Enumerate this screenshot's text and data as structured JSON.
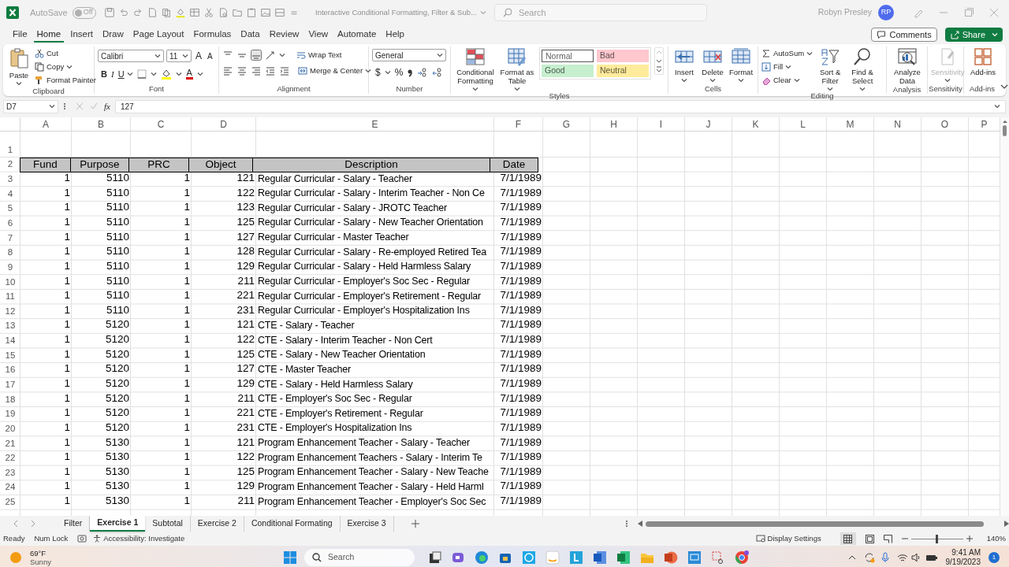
{
  "title_bar": {
    "autosave_label": "AutoSave",
    "autosave_state": "Off",
    "autosave_on": false,
    "document_title": "Interactive Conditional Formatting, Filter & Sub...",
    "search_placeholder": "Search",
    "user_name": "Robyn Presley",
    "user_initials": "RP"
  },
  "menu_tabs": [
    {
      "label": "File",
      "selected": false
    },
    {
      "label": "Home",
      "selected": true
    },
    {
      "label": "Insert",
      "selected": false
    },
    {
      "label": "Draw",
      "selected": false
    },
    {
      "label": "Page Layout",
      "selected": false
    },
    {
      "label": "Formulas",
      "selected": false
    },
    {
      "label": "Data",
      "selected": false
    },
    {
      "label": "Review",
      "selected": false
    },
    {
      "label": "View",
      "selected": false
    },
    {
      "label": "Automate",
      "selected": false
    },
    {
      "label": "Help",
      "selected": false
    }
  ],
  "comments_button": "Comments",
  "share_button": "Share",
  "ribbon": {
    "clipboard": {
      "paste": "Paste",
      "cut": "Cut",
      "copy": "Copy",
      "format_painter": "Format Painter",
      "label": "Clipboard"
    },
    "font": {
      "font_name": "Calibri",
      "font_size": "11",
      "grow": "A",
      "shrink": "A",
      "bold": "B",
      "italic": "I",
      "underline": "U",
      "font_color": "A",
      "label": "Font"
    },
    "alignment": {
      "wrap_text": "Wrap Text",
      "merge_center": "Merge & Center",
      "label": "Alignment"
    },
    "number": {
      "format": "General",
      "currency": "$",
      "percent": "%",
      "label": "Number"
    },
    "styles": {
      "conditional_formatting": "Conditional Formatting",
      "format_as_table": "Format as Table",
      "gallery": [
        {
          "label": "Normal",
          "color": "#ffffff"
        },
        {
          "label": "Bad",
          "color": "#ffc7ce"
        },
        {
          "label": "Good",
          "color": "#c6efce"
        },
        {
          "label": "Neutral",
          "color": "#ffeb9c"
        }
      ],
      "label": "Styles"
    },
    "cells": {
      "buttons": [
        "Insert",
        "Delete",
        "Format"
      ],
      "label": "Cells"
    },
    "editing": {
      "autosum": "AutoSum",
      "fill": "Fill",
      "clear": "Clear",
      "sort_filter": "Sort & Filter",
      "find_select": "Find & Select",
      "label": "Editing"
    },
    "analysis": {
      "analyze_data": "Analyze Data",
      "label": "Analysis"
    },
    "sensitivity": {
      "button": "Sensitivity",
      "disabled": true,
      "label": "Sensitivity"
    },
    "addins": {
      "button": "Add-ins",
      "label": "Add-ins"
    }
  },
  "formula_bar": {
    "name_box": "D7",
    "function_label": "fx",
    "value": "127"
  },
  "sheet": {
    "column_headers": [
      "A",
      "B",
      "C",
      "D",
      "E",
      "F",
      "G",
      "H",
      "I",
      "J",
      "K",
      "L",
      "M",
      "N",
      "O",
      "P"
    ],
    "rows": [
      {
        "number": "1",
        "kind": "blank"
      },
      {
        "number": "2",
        "kind": "header",
        "cells": [
          "Fund",
          "Purpose",
          "PRC",
          "Object",
          "Description",
          "Date"
        ]
      },
      {
        "number": "3",
        "kind": "data",
        "cells": [
          "1",
          "5110",
          "1",
          "121",
          "Regular Curricular - Salary - Teacher",
          "7/1/1989"
        ]
      },
      {
        "number": "4",
        "kind": "data",
        "cells": [
          "1",
          "5110",
          "1",
          "122",
          "Regular Curricular - Salary - Interim Teacher - Non Ce",
          "7/1/1989"
        ]
      },
      {
        "number": "5",
        "kind": "data",
        "cells": [
          "1",
          "5110",
          "1",
          "123",
          "Regular Curricular - Salary - JROTC Teacher",
          "7/1/1989"
        ]
      },
      {
        "number": "6",
        "kind": "data",
        "cells": [
          "1",
          "5110",
          "1",
          "125",
          "Regular Curricular - Salary - New Teacher Orientation",
          "7/1/1989"
        ]
      },
      {
        "number": "7",
        "kind": "data",
        "cells": [
          "1",
          "5110",
          "1",
          "127",
          "Regular Curricular - Master Teacher",
          "7/1/1989"
        ]
      },
      {
        "number": "8",
        "kind": "data",
        "cells": [
          "1",
          "5110",
          "1",
          "128",
          "Regular Curricular - Salary - Re-employed Retired Tea",
          "7/1/1989"
        ]
      },
      {
        "number": "9",
        "kind": "data",
        "cells": [
          "1",
          "5110",
          "1",
          "129",
          "Regular Curricular - Salary - Held Harmless Salary",
          "7/1/1989"
        ]
      },
      {
        "number": "10",
        "kind": "data",
        "cells": [
          "1",
          "5110",
          "1",
          "211",
          "Regular Curricular - Employer's Soc Sec - Regular",
          "7/1/1989"
        ]
      },
      {
        "number": "11",
        "kind": "data",
        "cells": [
          "1",
          "5110",
          "1",
          "221",
          "Regular Curricular - Employer's Retirement - Regular",
          "7/1/1989"
        ]
      },
      {
        "number": "12",
        "kind": "data",
        "cells": [
          "1",
          "5110",
          "1",
          "231",
          "Regular Curricular - Employer's Hospitalization Ins",
          "7/1/1989"
        ]
      },
      {
        "number": "13",
        "kind": "data",
        "cells": [
          "1",
          "5120",
          "1",
          "121",
          "CTE - Salary - Teacher",
          "7/1/1989"
        ]
      },
      {
        "number": "14",
        "kind": "data",
        "cells": [
          "1",
          "5120",
          "1",
          "122",
          "CTE - Salary - Interim Teacher - Non Cert",
          "7/1/1989"
        ]
      },
      {
        "number": "15",
        "kind": "data",
        "cells": [
          "1",
          "5120",
          "1",
          "125",
          "CTE - Salary - New Teacher Orientation",
          "7/1/1989"
        ]
      },
      {
        "number": "16",
        "kind": "data",
        "cells": [
          "1",
          "5120",
          "1",
          "127",
          "CTE - Master Teacher",
          "7/1/1989"
        ]
      },
      {
        "number": "17",
        "kind": "data",
        "cells": [
          "1",
          "5120",
          "1",
          "129",
          "CTE - Salary - Held Harmless Salary",
          "7/1/1989"
        ]
      },
      {
        "number": "18",
        "kind": "data",
        "cells": [
          "1",
          "5120",
          "1",
          "211",
          "CTE - Employer's Soc Sec - Regular",
          "7/1/1989"
        ]
      },
      {
        "number": "19",
        "kind": "data",
        "cells": [
          "1",
          "5120",
          "1",
          "221",
          "CTE - Employer's Retirement - Regular",
          "7/1/1989"
        ]
      },
      {
        "number": "20",
        "kind": "data",
        "cells": [
          "1",
          "5120",
          "1",
          "231",
          "CTE - Employer's Hospitalization Ins",
          "7/1/1989"
        ]
      },
      {
        "number": "21",
        "kind": "data",
        "cells": [
          "1",
          "5130",
          "1",
          "121",
          "Program Enhancement Teacher - Salary - Teacher",
          "7/1/1989"
        ]
      },
      {
        "number": "22",
        "kind": "data",
        "cells": [
          "1",
          "5130",
          "1",
          "122",
          "Program Enhancement Teachers - Salary - Interim Te",
          "7/1/1989"
        ]
      },
      {
        "number": "23",
        "kind": "data",
        "cells": [
          "1",
          "5130",
          "1",
          "125",
          "Program Enhancement Teacher - Salary - New Teache",
          "7/1/1989"
        ]
      },
      {
        "number": "24",
        "kind": "data",
        "cells": [
          "1",
          "5130",
          "1",
          "129",
          "Program Enhancement Teacher - Salary - Held Harml",
          "7/1/1989"
        ]
      },
      {
        "number": "25",
        "kind": "data",
        "cells": [
          "1",
          "5130",
          "1",
          "211",
          "Program Enhancement Teacher - Employer's Soc Sec",
          "7/1/1989"
        ]
      }
    ]
  },
  "sheet_tabs": [
    {
      "label": "Filter",
      "selected": false
    },
    {
      "label": "Exercise 1",
      "selected": true
    },
    {
      "label": "Subtotal",
      "selected": false
    },
    {
      "label": "Exercise 2",
      "selected": false
    },
    {
      "label": "Conditional Formating",
      "selected": false
    },
    {
      "label": "Exercise 3",
      "selected": false
    }
  ],
  "status_bar": {
    "ready": "Ready",
    "num_lock": "Num Lock",
    "accessibility": "Accessibility: Investigate",
    "display_settings": "Display Settings",
    "zoom": "140%",
    "zoom_slider": {
      "level": 0.5
    }
  },
  "taskbar": {
    "temperature": "69°F",
    "weather": "Sunny",
    "search_placeholder": "Search",
    "time": "9:41 AM",
    "date": "9/19/2023",
    "notification_count": "1"
  }
}
